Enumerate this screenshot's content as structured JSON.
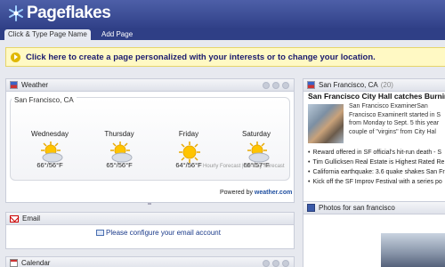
{
  "brand": {
    "logo_text": "Pageflakes"
  },
  "tabs": {
    "active_label": "Click & Type Page Name",
    "add_label": "Add Page"
  },
  "banner": {
    "text": "Click here to create a page personalized with your interests or to change your location."
  },
  "weather": {
    "title": "Weather",
    "location": "San Francisco, CA",
    "days": [
      {
        "name": "Wednesday",
        "temp": "66°/56°F",
        "icon": "partly-cloudy-icon"
      },
      {
        "name": "Thursday",
        "temp": "65°/56°F",
        "icon": "partly-cloudy-icon"
      },
      {
        "name": "Friday",
        "temp": "64°/56°F",
        "icon": "sunny-icon"
      },
      {
        "name": "Saturday",
        "temp": "66°/57°F",
        "icon": "partly-cloudy-icon"
      }
    ],
    "forecast_links": "Hourly Forecast | 10-Day Forecast",
    "powered_prefix": "Powered by",
    "powered_brand": "weather.com"
  },
  "email": {
    "title": "Email",
    "link": "Please configure your email account"
  },
  "calendar": {
    "title": "Calendar"
  },
  "news": {
    "title": "San Francisco, CA",
    "count": "(20)",
    "headline": "San Francisco City Hall catches Burning M",
    "paragraph": [
      "San Francisco ExaminerSan",
      "Francisco ExaminerIt started in S",
      "from Monday to Sept. 5 this year",
      "couple of \"virgins\" from City Hal"
    ],
    "items": [
      "Reward offered in SF official's hit-run death - S",
      "Tim Gullicksen Real Estate is Highest Rated Re",
      "California earthquake: 3.6 quake shakes San Fra",
      "Kick off the SF Improv Festival with a series po"
    ]
  },
  "photos": {
    "title": "Photos for san francisco"
  }
}
